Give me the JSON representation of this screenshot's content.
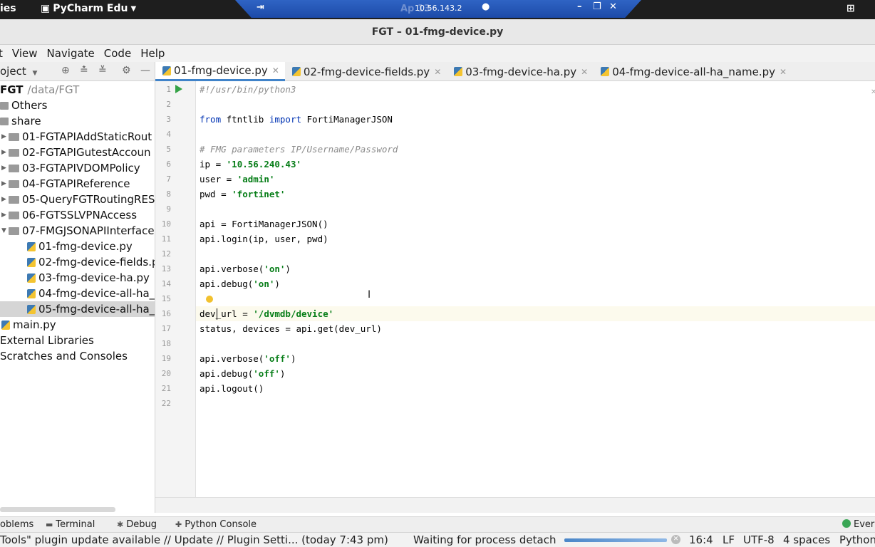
{
  "system_bar": {
    "activities": "ies",
    "app_name": "PyCharm Edu",
    "remote_host": "10.56.143.2",
    "remote_ghost": "Ap              13"
  },
  "window": {
    "title": "FGT – 01-fmg-device.py"
  },
  "menu": [
    "t",
    "View",
    "Navigate",
    "Code",
    "Help"
  ],
  "project_panel": {
    "label": "oject"
  },
  "tabs": [
    {
      "label": "01-fmg-device.py",
      "active": true
    },
    {
      "label": "02-fmg-device-fields.py",
      "active": false
    },
    {
      "label": "03-fmg-device-ha.py",
      "active": false
    },
    {
      "label": "04-fmg-device-all-ha_name.py",
      "active": false
    }
  ],
  "tree": {
    "root": {
      "name": "FGT",
      "path": "/data/FGT"
    },
    "others": "Others",
    "share": "share",
    "folders": [
      "01-FGTAPIAddStaticRout",
      "02-FGTAPIGutestAccoun",
      "03-FGTAPIVDOMPolicy",
      "04-FGTAPIReference",
      "05-QueryFGTRoutingRES",
      "06-FGTSSLVPNAccess",
      "07-FMGJSONAPIInterface"
    ],
    "files": [
      "01-fmg-device.py",
      "02-fmg-device-fields.p",
      "03-fmg-device-ha.py",
      "04-fmg-device-all-ha_",
      "05-fmg-device-all-ha_"
    ],
    "main": "main.py",
    "external": "External Libraries",
    "scratches": "Scratches and Consoles"
  },
  "code": {
    "line_numbers": [
      "1",
      "2",
      "3",
      "4",
      "5",
      "6",
      "7",
      "8",
      "9",
      "10",
      "11",
      "12",
      "13",
      "14",
      "15",
      "16",
      "17",
      "18",
      "19",
      "20",
      "21",
      "22"
    ],
    "l1": "#!/usr/bin/python3",
    "l3_kw1": "from",
    "l3_mod": " ftntlib ",
    "l3_kw2": "import",
    "l3_name": " FortiManagerJSON",
    "l5": "# FMG parameters IP/Username/Password",
    "l6_a": "ip = ",
    "l6_s": "'10.56.240.43'",
    "l7_a": "user = ",
    "l7_s": "'admin'",
    "l8_a": "pwd = ",
    "l8_s": "'fortinet'",
    "l10": "api = FortiManagerJSON()",
    "l11": "api.login(ip, user, pwd)",
    "l13_a": "api.verbose(",
    "l13_s": "'on'",
    "l13_b": ")",
    "l14_a": "api.debug(",
    "l14_s": "'on'",
    "l14_b": ")",
    "l16_a": "dev_url = ",
    "l16_s": "'/dvmdb/device'",
    "l17": "status, devices = api.get(dev_url)",
    "l19_a": "api.verbose(",
    "l19_s": "'off'",
    "l19_b": ")",
    "l20_a": "api.debug(",
    "l20_s": "'off'",
    "l20_b": ")",
    "l21": "api.logout()"
  },
  "bottom_tools": {
    "problems": "oblems",
    "terminal": "Terminal",
    "debug": "Debug",
    "python_console": "Python Console",
    "event_log": "Ever"
  },
  "status": {
    "message": "Tools\" plugin update available // Update // Plugin Setti... (today 7:43 pm)",
    "process": "Waiting for process detach",
    "progress": 1.0,
    "position": "16:4",
    "line_sep": "LF",
    "encoding": "UTF-8",
    "indent": "4 spaces",
    "interpreter": "Python"
  },
  "colors": {
    "keyword": "#0033b3",
    "string": "#067d17",
    "comment": "#8c8c8c",
    "tab_accent": "#4083c9",
    "run_icon": "#36a347"
  }
}
